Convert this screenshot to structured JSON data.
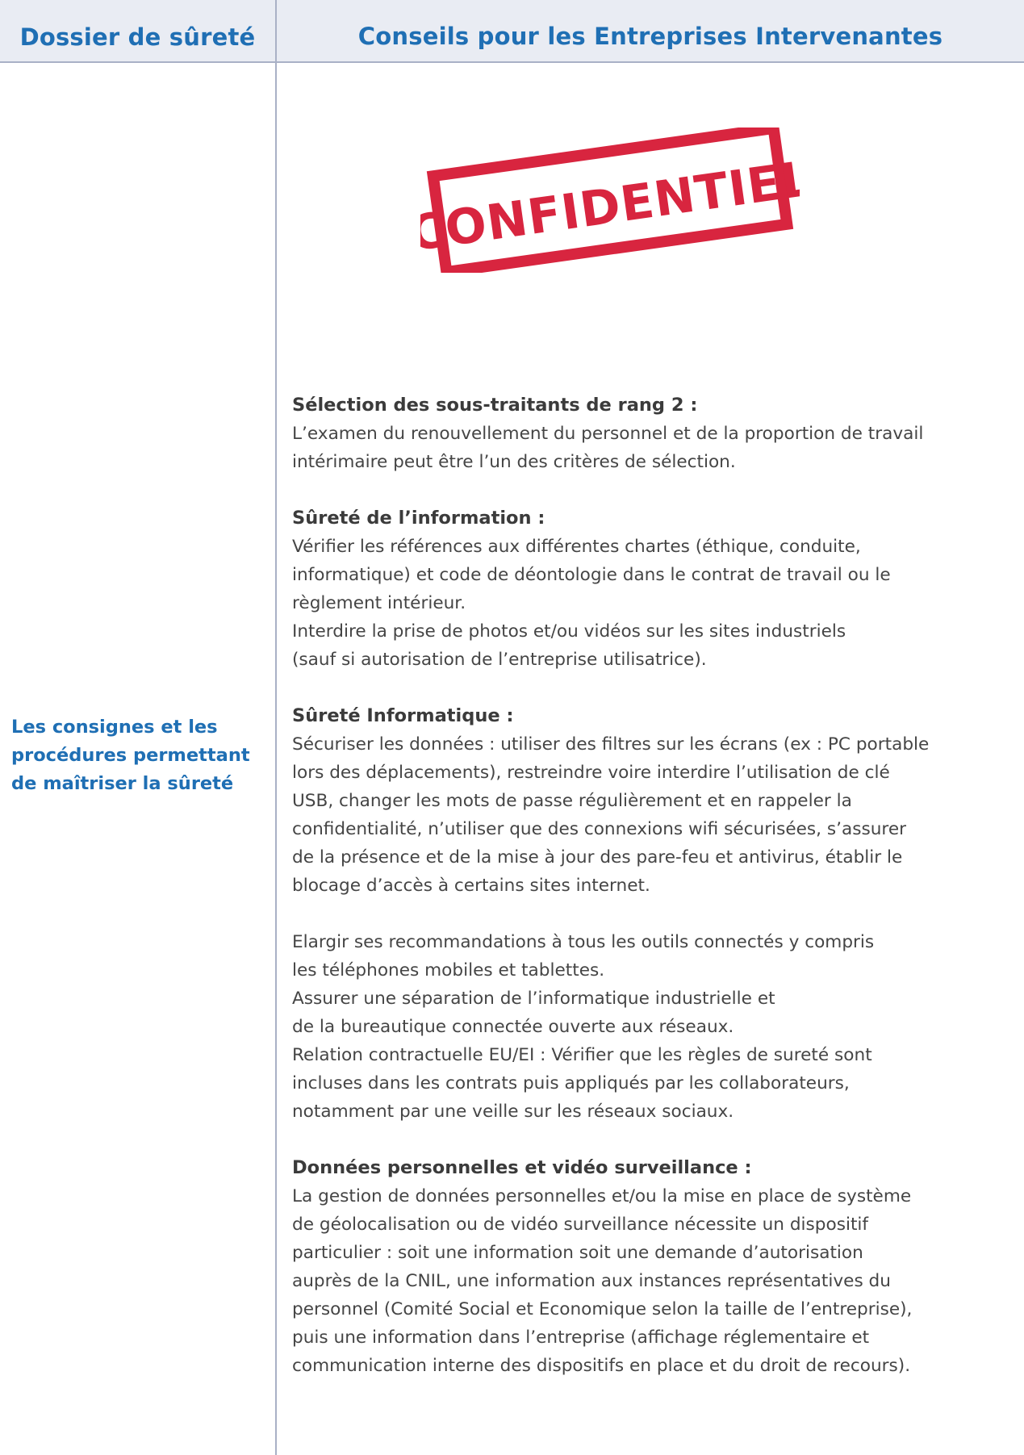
{
  "header": {
    "left": "Dossier de sûreté",
    "right": "Conseils pour les Entreprises Intervenantes"
  },
  "stamp": {
    "text": "CONFIDENTIEL",
    "color": "#d8253f"
  },
  "left_label": [
    "Les consignes et les",
    "procédures permettant",
    "de maîtriser la sûreté"
  ],
  "sections": [
    {
      "title": "Sélection des sous-traitants de rang 2 :",
      "lines": [
        "L’examen du renouvellement du personnel et de la proportion de travail",
        "intérimaire peut être l’un des critères de sélection."
      ]
    },
    {
      "title": "Sûreté de l’information :",
      "lines": [
        "Vérifier les références aux différentes chartes (éthique, conduite,",
        "informatique) et code de déontologie dans le contrat de travail ou le",
        "règlement intérieur.",
        "Interdire la prise de photos et/ou vidéos sur les sites industriels",
        "(sauf si autorisation de l’entreprise utilisatrice)."
      ]
    },
    {
      "title": "Sûreté Informatique :",
      "lines": [
        "Sécuriser les données : utiliser des filtres sur les écrans (ex : PC portable",
        "lors des déplacements), restreindre voire interdire l’utilisation de clé",
        "USB, changer les mots de passe régulièrement et en rappeler la",
        "confidentialité, n’utiliser que des connexions wifi sécurisées, s’assurer",
        "de la présence et de la mise à jour des pare-feu et antivirus, établir le",
        "blocage d’accès à certains sites internet.",
        "",
        "Elargir ses recommandations à tous les outils connectés y compris",
        "les téléphones mobiles et tablettes.",
        "Assurer une séparation de l’informatique industrielle et",
        "de la bureautique connectée ouverte aux réseaux.",
        "Relation contractuelle EU/EI : Vérifier que les règles de sureté sont",
        "incluses dans les contrats puis appliqués par les collaborateurs,",
        "notamment par une veille sur les réseaux sociaux."
      ]
    },
    {
      "title": "Données personnelles et vidéo surveillance :",
      "lines": [
        "La gestion de données personnelles et/ou la mise en place de système",
        "de géolocalisation ou de vidéo surveillance nécessite un dispositif",
        "particulier : soit une information soit une demande d’autorisation",
        "auprès de la CNIL, une information aux instances représentatives du",
        "personnel (Comité Social et Economique selon la taille de l’entreprise),",
        "puis une information dans l’entreprise (affichage réglementaire et",
        "communication interne des dispositifs en place et du droit de recours)."
      ]
    }
  ]
}
